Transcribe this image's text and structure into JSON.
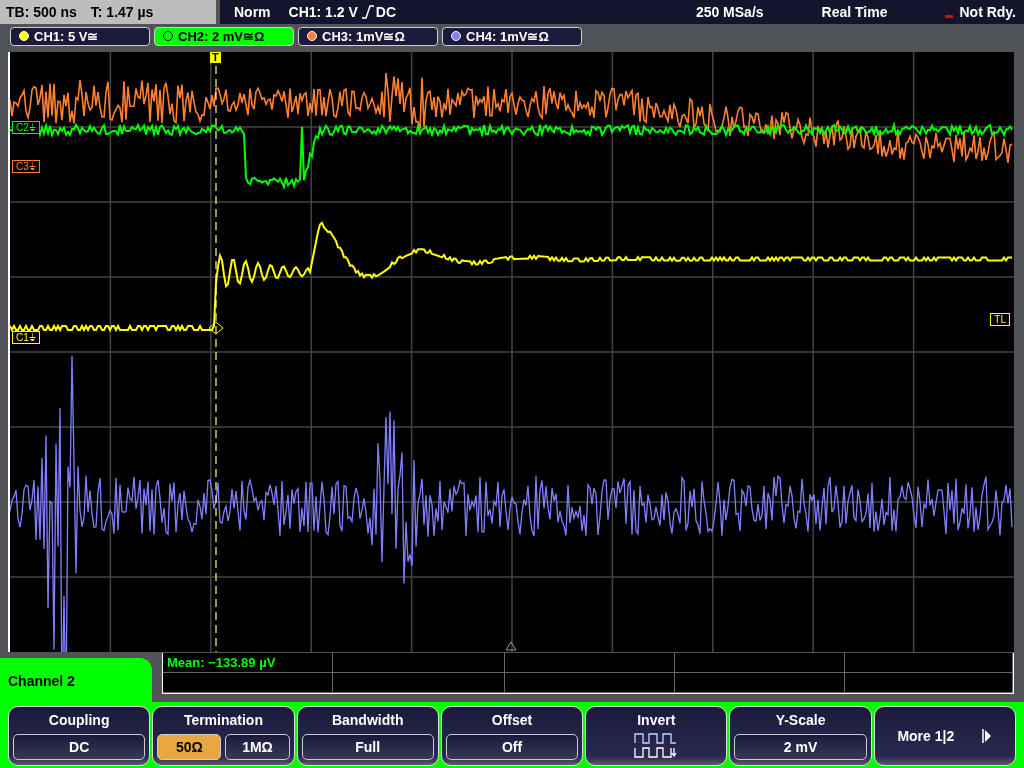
{
  "status_bar": {
    "timebase": "TB: 500 ns",
    "trigger_time": "T: 1.47 µs",
    "mode": "Norm",
    "trigger_level": "CH1: 1.2 V",
    "trigger_coupling": "DC",
    "sample_rate": "250 MSa/s",
    "acquisition": "Real Time",
    "state": "Not Rdy."
  },
  "channels": [
    {
      "label": "CH1: 5 V≅",
      "color": "#ffff00",
      "selected": false
    },
    {
      "label": "CH2: 2 mV≅Ω",
      "color": "#00ff00",
      "selected": true
    },
    {
      "label": "CH3: 1mV≅Ω",
      "color": "#ff8030",
      "selected": false
    },
    {
      "label": "CH4: 1mV≅Ω",
      "color": "#8080ff",
      "selected": false
    }
  ],
  "markers": [
    {
      "kind": "ground",
      "label": "C2⏚",
      "color": "#00ff00"
    },
    {
      "kind": "ground",
      "label": "C3⏚",
      "color": "#ff8030"
    },
    {
      "kind": "ground",
      "label": "C1⏚",
      "color": "#ffff00"
    },
    {
      "kind": "level",
      "label": "TL",
      "color": "#ffff00"
    }
  ],
  "trigger_marker": "T",
  "measurements": [
    {
      "text": "Mean: −133.89 µV"
    }
  ],
  "menu": {
    "title": "Channel 2",
    "softkeys": [
      {
        "kind": "value",
        "label": "Coupling",
        "value": "DC"
      },
      {
        "kind": "toggle",
        "label": "Termination",
        "options": [
          {
            "label": "50Ω",
            "selected": true
          },
          {
            "label": "1MΩ",
            "selected": false
          }
        ]
      },
      {
        "kind": "value",
        "label": "Bandwidth",
        "value": "Full"
      },
      {
        "kind": "value",
        "label": "Offset",
        "value": "Off"
      },
      {
        "kind": "icon",
        "label": "Invert"
      },
      {
        "kind": "value",
        "label": "Y-Scale",
        "value": "2 mV"
      },
      {
        "kind": "more",
        "label": "More 1|2"
      }
    ]
  }
}
